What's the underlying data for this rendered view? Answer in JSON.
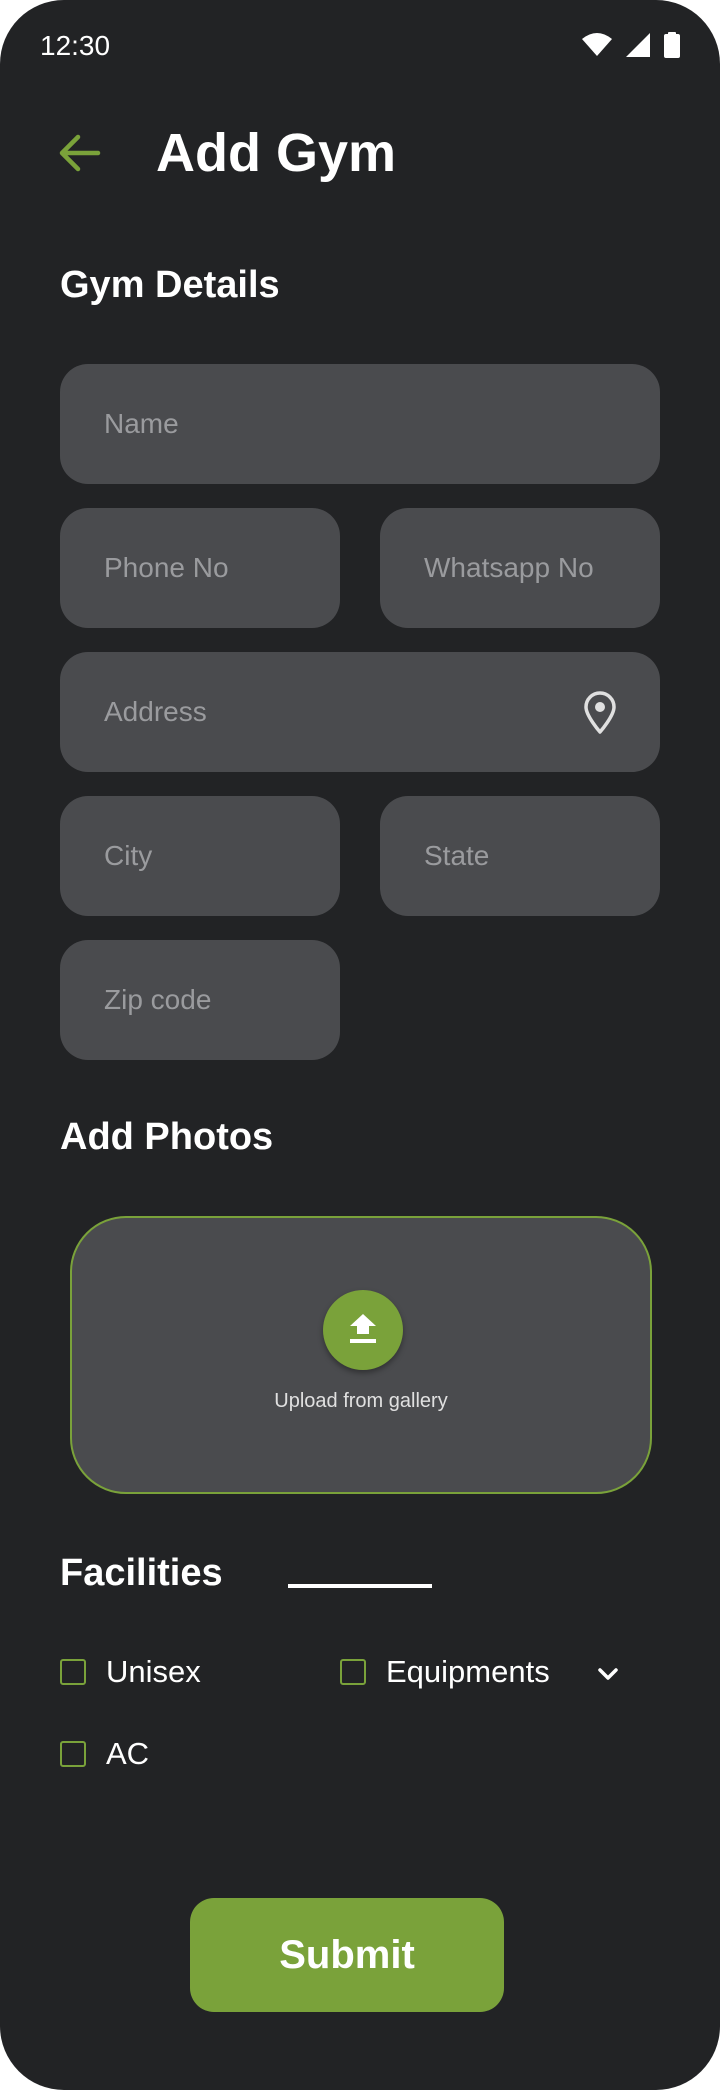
{
  "status_bar": {
    "time": "12:30"
  },
  "header": {
    "title": "Add Gym"
  },
  "gym_details": {
    "title": "Gym Details",
    "fields": {
      "name": {
        "placeholder": "Name"
      },
      "phone": {
        "placeholder": "Phone No"
      },
      "whatsapp": {
        "placeholder": "Whatsapp No"
      },
      "address": {
        "placeholder": "Address"
      },
      "city": {
        "placeholder": "City"
      },
      "state": {
        "placeholder": "State"
      },
      "zip": {
        "placeholder": "Zip code"
      }
    }
  },
  "photos": {
    "title": "Add Photos",
    "upload_label": "Upload from gallery"
  },
  "facilities": {
    "title": "Facilities",
    "options": {
      "unisex": "Unisex",
      "equipments": "Equipments",
      "ac": "AC"
    }
  },
  "submit": {
    "label": "Submit"
  },
  "colors": {
    "accent": "#7aa23a",
    "background": "#222325",
    "field": "#4a4b4e"
  }
}
